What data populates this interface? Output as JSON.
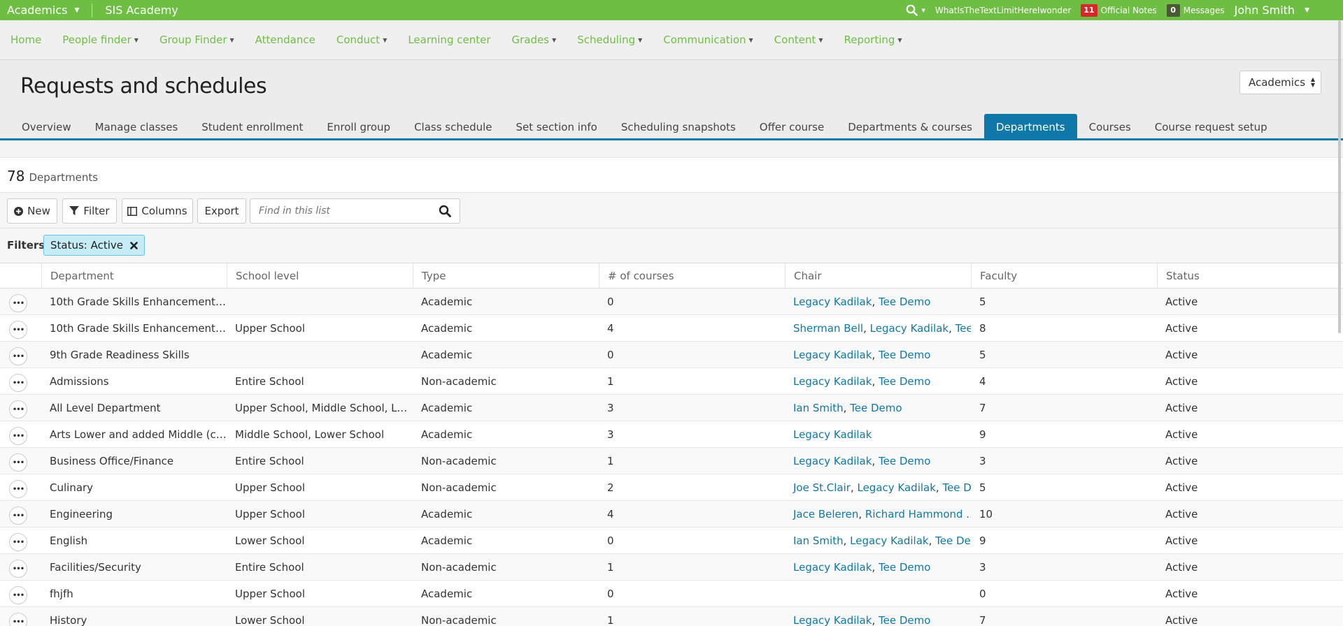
{
  "topbar": {
    "context": "Academics",
    "school": "SIS Academy",
    "username_long": "WhatIsTheTextLimitHereIwonder",
    "notes": {
      "count": "11",
      "label": "Official Notes"
    },
    "messages": {
      "count": "0",
      "label": "Messages"
    },
    "user": "John Smith"
  },
  "nav": [
    {
      "label": "Home",
      "dropdown": false
    },
    {
      "label": "People finder",
      "dropdown": true
    },
    {
      "label": "Group Finder",
      "dropdown": true
    },
    {
      "label": "Attendance",
      "dropdown": false
    },
    {
      "label": "Conduct",
      "dropdown": true
    },
    {
      "label": "Learning center",
      "dropdown": false
    },
    {
      "label": "Grades",
      "dropdown": true
    },
    {
      "label": "Scheduling",
      "dropdown": true
    },
    {
      "label": "Communication",
      "dropdown": true
    },
    {
      "label": "Content",
      "dropdown": true
    },
    {
      "label": "Reporting",
      "dropdown": true
    }
  ],
  "page": {
    "title": "Requests and schedules",
    "context_select": "Academics"
  },
  "tabs": [
    {
      "label": "Overview",
      "active": false
    },
    {
      "label": "Manage classes",
      "active": false
    },
    {
      "label": "Student enrollment",
      "active": false
    },
    {
      "label": "Enroll group",
      "active": false
    },
    {
      "label": "Class schedule",
      "active": false
    },
    {
      "label": "Set section info",
      "active": false
    },
    {
      "label": "Scheduling snapshots",
      "active": false
    },
    {
      "label": "Offer course",
      "active": false
    },
    {
      "label": "Departments & courses",
      "active": false
    },
    {
      "label": "Departments",
      "active": true
    },
    {
      "label": "Courses",
      "active": false
    },
    {
      "label": "Course request setup",
      "active": false
    }
  ],
  "list": {
    "count": "78",
    "count_label": "Departments"
  },
  "toolbar": {
    "new_label": "New",
    "filter_label": "Filter",
    "columns_label": "Columns",
    "export_label": "Export",
    "search_placeholder": "Find in this list"
  },
  "filters": {
    "label": "Filters:",
    "chips": [
      "Status: Active"
    ]
  },
  "table": {
    "columns": [
      "Department",
      "School level",
      "Type",
      "# of courses",
      "Chair",
      "Faculty",
      "Status"
    ],
    "rows": [
      {
        "department": "10th Grade Skills Enhancement, E...",
        "school_level": "",
        "type": "Academic",
        "courses": "0",
        "chair": [
          "Legacy Kadilak",
          "Tee Demo"
        ],
        "faculty": "5",
        "status": "Active"
      },
      {
        "department": "10th Grade Skills Enhancement, ...",
        "school_level": "Upper School",
        "type": "Academic",
        "courses": "4",
        "chair": [
          "Sherman Bell",
          "Legacy Kadilak",
          "Tee..."
        ],
        "faculty": "8",
        "status": "Active"
      },
      {
        "department": "9th Grade Readiness Skills",
        "school_level": "",
        "type": "Academic",
        "courses": "0",
        "chair": [
          "Legacy Kadilak",
          "Tee Demo"
        ],
        "faculty": "5",
        "status": "Active"
      },
      {
        "department": "Admissions",
        "school_level": "Entire School",
        "type": "Non-academic",
        "courses": "1",
        "chair": [
          "Legacy Kadilak",
          "Tee Demo"
        ],
        "faculty": "4",
        "status": "Active"
      },
      {
        "department": "All Level Department",
        "school_level": "Upper School, Middle School, Lo...",
        "type": "Academic",
        "courses": "3",
        "chair": [
          "Ian Smith",
          "Tee Demo"
        ],
        "faculty": "7",
        "status": "Active"
      },
      {
        "department": "Arts Lower and added Middle (ch...",
        "school_level": "Middle School, Lower School",
        "type": "Academic",
        "courses": "3",
        "chair": [
          "Legacy Kadilak"
        ],
        "faculty": "9",
        "status": "Active"
      },
      {
        "department": "Business Office/Finance",
        "school_level": "Entire School",
        "type": "Non-academic",
        "courses": "1",
        "chair": [
          "Legacy Kadilak",
          "Tee Demo"
        ],
        "faculty": "3",
        "status": "Active"
      },
      {
        "department": "Culinary",
        "school_level": "Upper School",
        "type": "Non-academic",
        "courses": "2",
        "chair": [
          "Joe St.Clair",
          "Legacy Kadilak",
          "Tee D..."
        ],
        "faculty": "5",
        "status": "Active"
      },
      {
        "department": "Engineering",
        "school_level": "Upper School",
        "type": "Academic",
        "courses": "4",
        "chair": [
          "Jace Beleren",
          "Richard Hammond ..."
        ],
        "faculty": "10",
        "status": "Active"
      },
      {
        "department": "English",
        "school_level": "Lower School",
        "type": "Academic",
        "courses": "0",
        "chair": [
          "Ian Smith",
          "Legacy Kadilak",
          "Tee De..."
        ],
        "faculty": "9",
        "status": "Active"
      },
      {
        "department": "Facilities/Security",
        "school_level": "Entire School",
        "type": "Non-academic",
        "courses": "1",
        "chair": [
          "Legacy Kadilak",
          "Tee Demo"
        ],
        "faculty": "3",
        "status": "Active"
      },
      {
        "department": "fhjfh",
        "school_level": "Upper School",
        "type": "Academic",
        "courses": "0",
        "chair": [],
        "faculty": "0",
        "status": "Active"
      },
      {
        "department": "History",
        "school_level": "Lower School",
        "type": "Non-academic",
        "courses": "1",
        "chair": [
          "Legacy Kadilak",
          "Tee Demo"
        ],
        "faculty": "7",
        "status": "Active"
      }
    ]
  },
  "colors": {
    "brand_green": "#6fbe44",
    "tab_active": "#0e78a8",
    "link": "#0e78a8",
    "badge_red": "#d9262a"
  }
}
